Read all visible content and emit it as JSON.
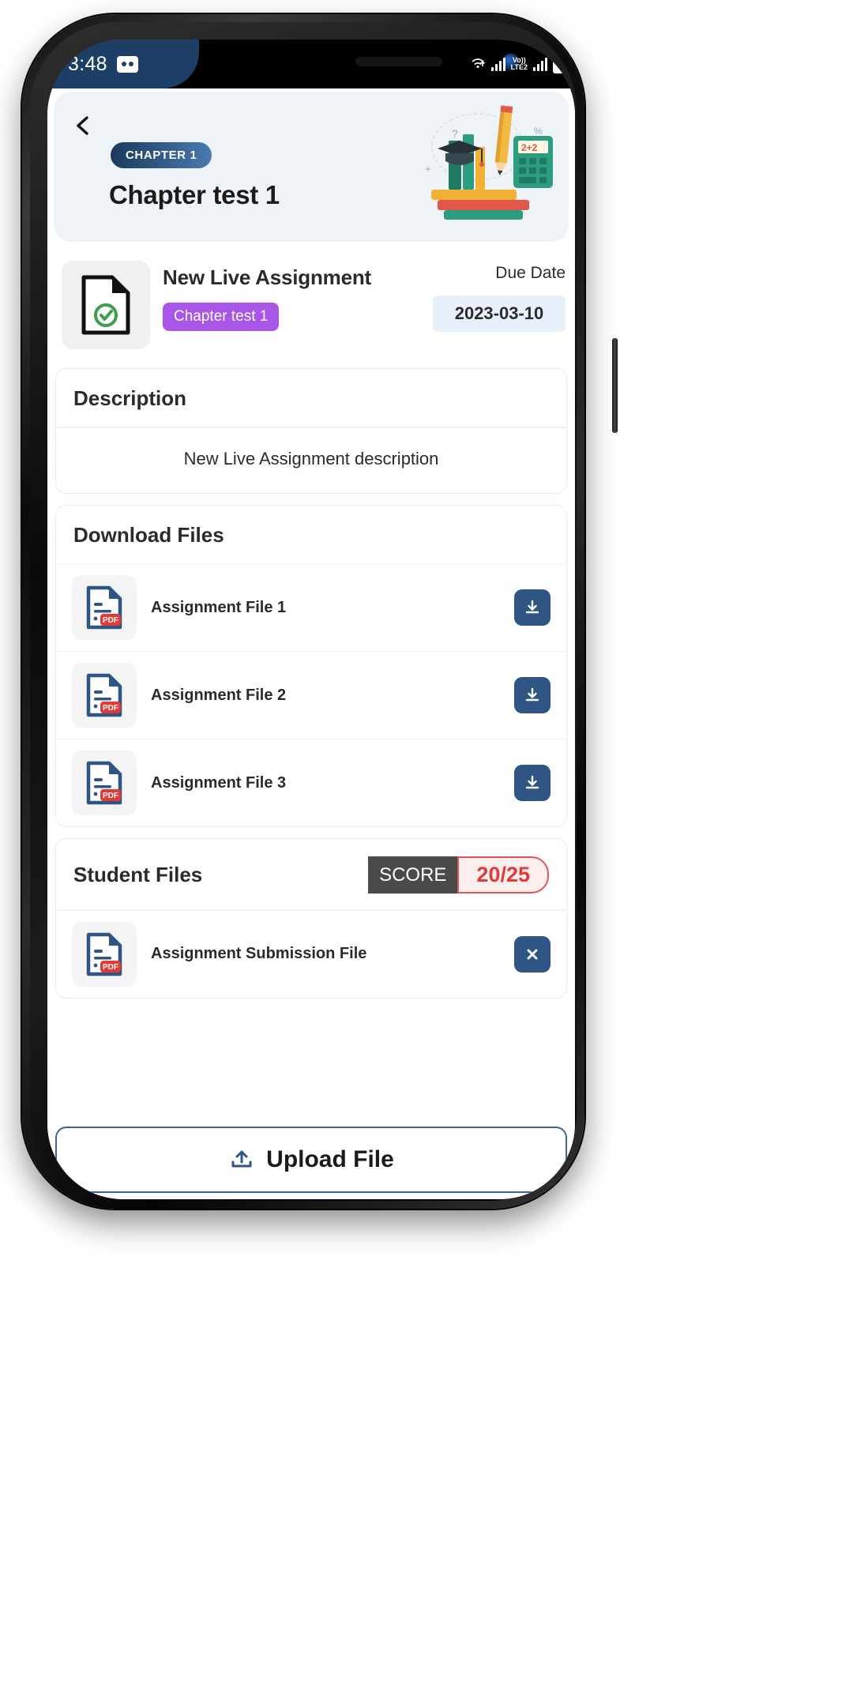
{
  "status_bar": {
    "time": "3:48",
    "voicemail_icon": "voicemail-icon",
    "wifi_icon": "wifi-upload-icon",
    "network_label": "Vo))\nLTE2",
    "volte_line1": "Vo))",
    "volte_line2": "LTE2",
    "battery_icon": "battery-icon"
  },
  "hero": {
    "back_icon": "back-chevron-icon",
    "chapter_badge": "CHAPTER 1",
    "title": "Chapter test 1",
    "illustration": "education-supplies-illustration"
  },
  "assignment": {
    "doc_icon": "document-verified-icon",
    "title": "New Live Assignment",
    "tag": "Chapter test 1",
    "due_label": "Due Date",
    "due_date": "2023-03-10"
  },
  "description": {
    "heading": "Description",
    "text": "New Live Assignment description"
  },
  "download_files": {
    "heading": "Download Files",
    "files": [
      {
        "name": "Assignment File 1",
        "icon": "pdf-file-icon",
        "action": "download-icon"
      },
      {
        "name": "Assignment File 2",
        "icon": "pdf-file-icon",
        "action": "download-icon"
      },
      {
        "name": "Assignment File 3",
        "icon": "pdf-file-icon",
        "action": "download-icon"
      }
    ]
  },
  "student_files": {
    "heading": "Student Files",
    "score_label": "SCORE",
    "score_value": "20/25",
    "files": [
      {
        "name": "Assignment Submission File",
        "icon": "pdf-file-icon",
        "action": "remove-icon"
      }
    ]
  },
  "upload": {
    "label": "Upload File",
    "icon": "upload-icon"
  },
  "colors": {
    "status_bar_accent": "#1d3f66",
    "hero_bg": "#eef3f7",
    "chapter_badge_from": "#1b3a5c",
    "chapter_badge_to": "#4a7ab0",
    "tag_purple": "#a855e8",
    "due_pill_bg": "#e8f0fb",
    "action_blue": "#2e5584",
    "score_label_bg": "#4a4a4a",
    "score_value_red": "#e03b3b",
    "upload_border": "#3b63a0"
  }
}
